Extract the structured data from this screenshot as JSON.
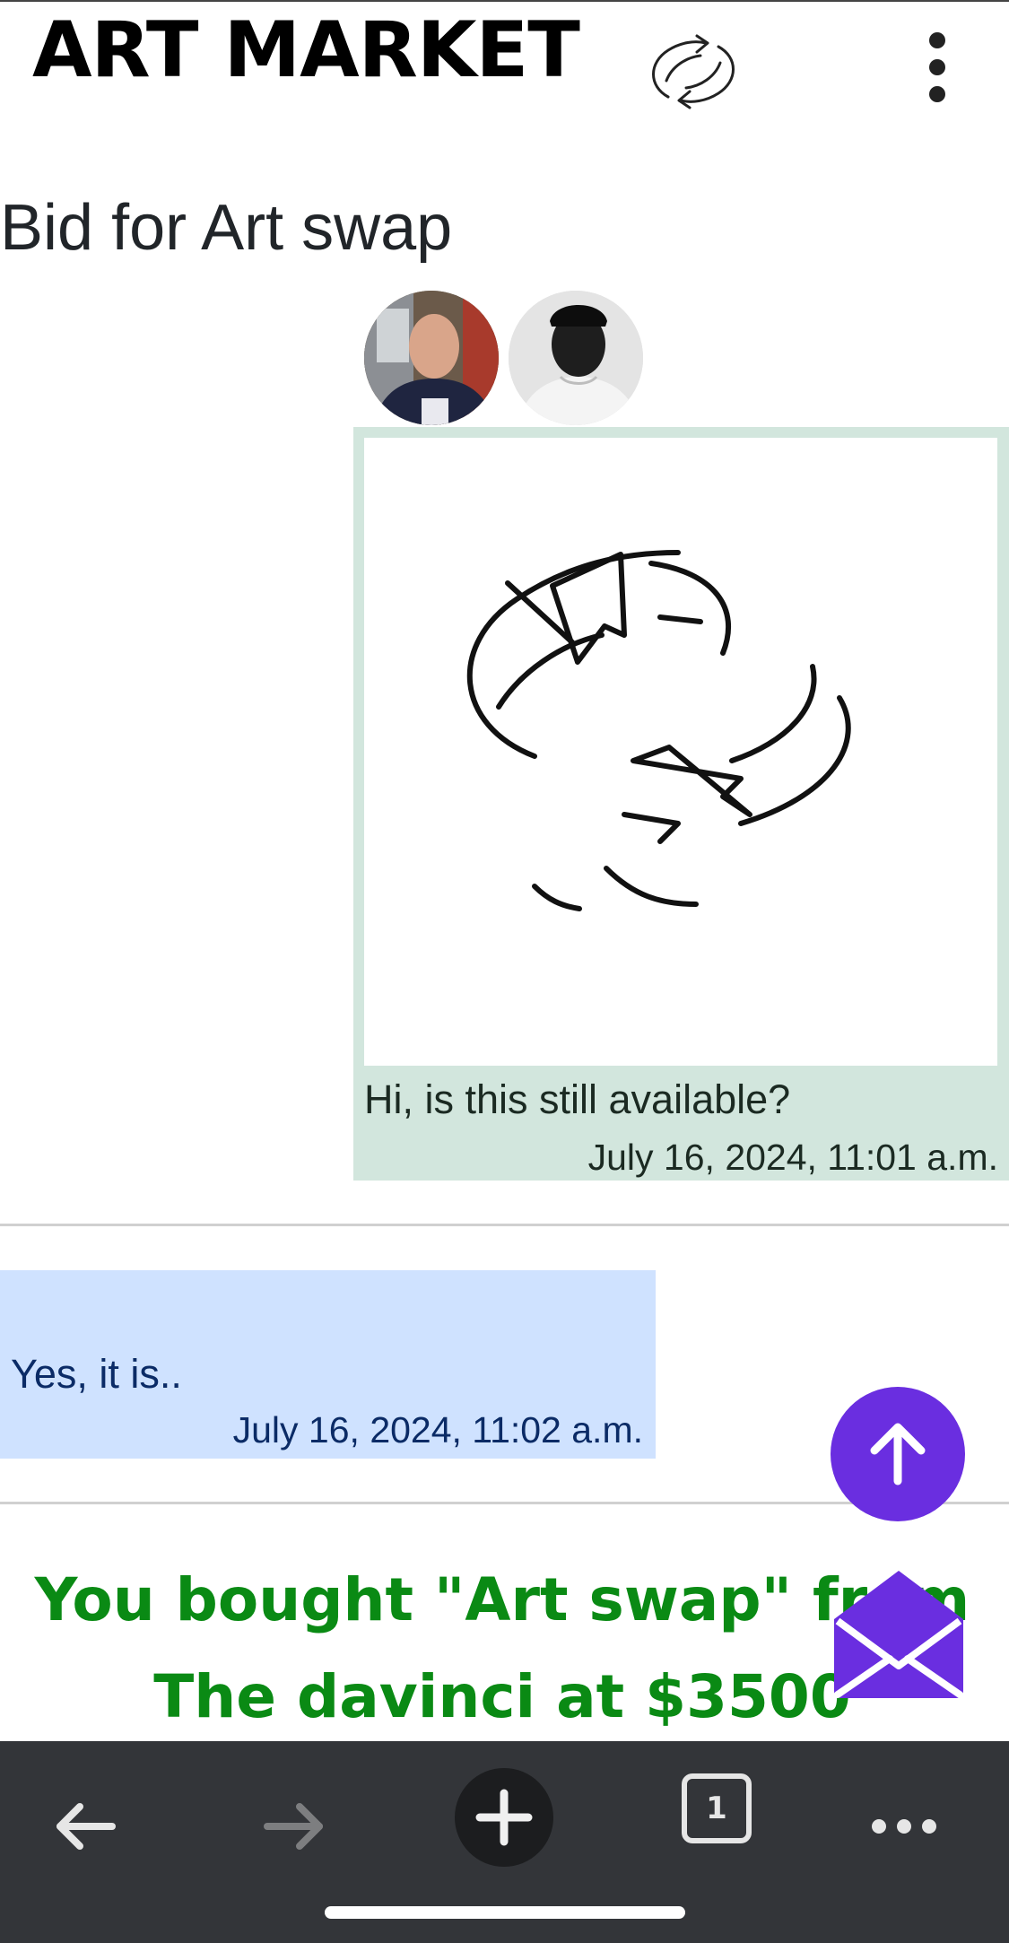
{
  "header": {
    "brand": "ART MARKET",
    "logo_icon": "swap-arrows-icon",
    "menu_icon": "more-vertical-icon"
  },
  "page": {
    "title": "Bid for Art swap"
  },
  "participants": [
    {
      "avatar": "avatar-user-1"
    },
    {
      "avatar": "avatar-user-2"
    }
  ],
  "messages": [
    {
      "direction": "sent",
      "image_icon": "swap-arrows-icon",
      "text": "Hi, is this still available?",
      "time": "July 16, 2024, 11:01 a.m."
    },
    {
      "direction": "received",
      "text": "Yes, it is..",
      "time": "July 16, 2024, 11:02 a.m."
    }
  ],
  "purchase": {
    "line1": "You bought \"Art swap\" from",
    "line2": "The davinci at $3500"
  },
  "fab": {
    "scroll_top_icon": "arrow-up-icon",
    "mail_icon": "envelope-open-icon"
  },
  "browser_bar": {
    "back_icon": "arrow-left-icon",
    "forward_icon": "arrow-right-icon",
    "new_tab_icon": "plus-icon",
    "tab_count": "1",
    "more_icon": "more-horizontal-icon"
  },
  "colors": {
    "sent_bubble": "#d2e6dd",
    "received_bubble": "#cfe2ff",
    "purchase_text": "#0a8a14",
    "fab": "#6a2ee0",
    "browser_bar": "#333539"
  }
}
